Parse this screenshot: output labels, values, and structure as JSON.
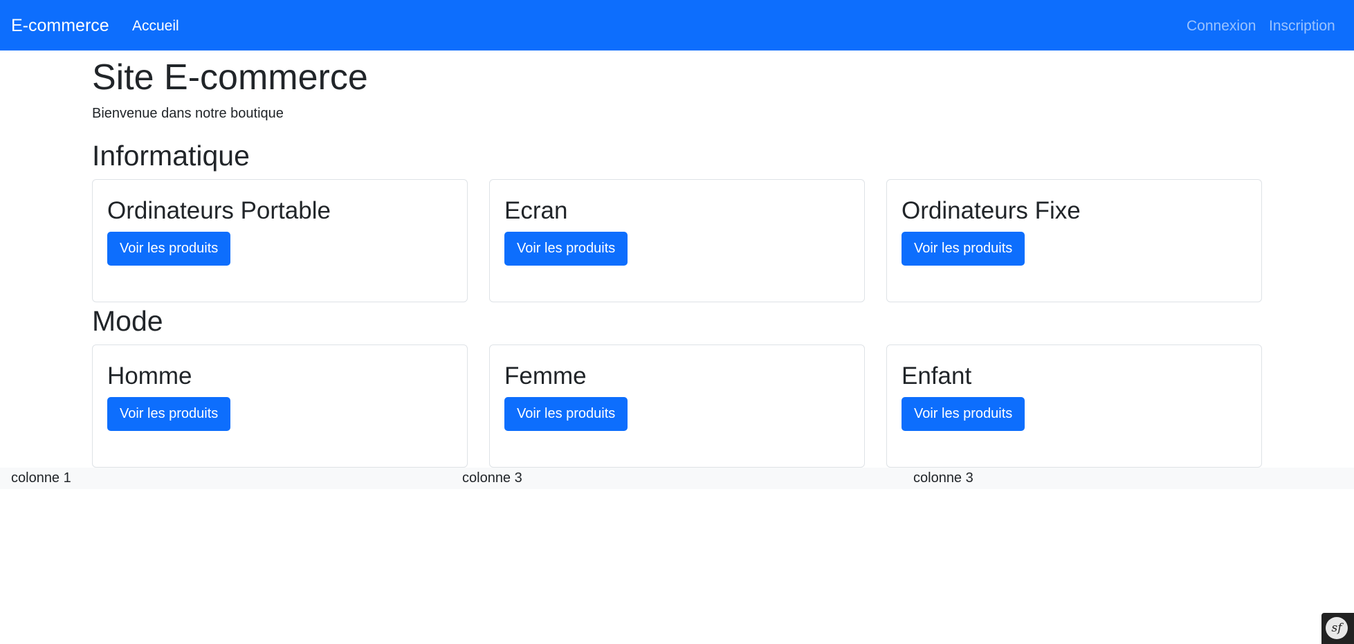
{
  "navbar": {
    "brand": "E-commerce",
    "home": "Accueil",
    "login": "Connexion",
    "register": "Inscription",
    "color": "#0d6efd"
  },
  "main": {
    "title": "Site E-commerce",
    "subtitle": "Bienvenue dans notre boutique",
    "sections": [
      {
        "title": "Informatique",
        "cards": [
          {
            "title": "Ordinateurs Portable",
            "button": "Voir les produits"
          },
          {
            "title": "Ecran",
            "button": "Voir les produits"
          },
          {
            "title": "Ordinateurs Fixe",
            "button": "Voir les produits"
          }
        ]
      },
      {
        "title": "Mode",
        "cards": [
          {
            "title": "Homme",
            "button": "Voir les produits"
          },
          {
            "title": "Femme",
            "button": "Voir les produits"
          },
          {
            "title": "Enfant",
            "button": "Voir les produits"
          }
        ]
      }
    ]
  },
  "footer": {
    "columns": [
      "colonne 1",
      "colonne 3",
      "colonne 3"
    ]
  },
  "debug_toolbar": {
    "icon": "symfony-logo-icon",
    "logo_text": "sf"
  }
}
